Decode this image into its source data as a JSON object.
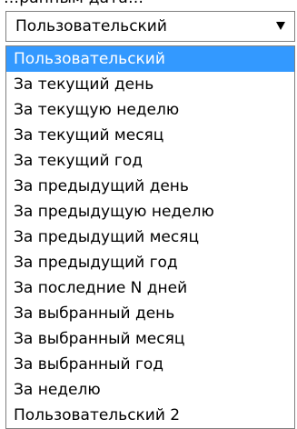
{
  "top_fragment": "…ранным дата…",
  "select": {
    "selected_value": "Пользовательский",
    "icon": "chevron-down-icon"
  },
  "dropdown": {
    "selected_index": 0,
    "options": [
      "Пользовательский",
      "За текущий день",
      "За текущую неделю",
      "За текущий месяц",
      "За текущий год",
      "За предыдущий день",
      "За предыдущую неделю",
      "За предыдущий месяц",
      "За предыдущий год",
      "За последние N дней",
      "За выбранный день",
      "За выбранный месяц",
      "За выбранный год",
      "За неделю",
      "Пользовательский 2"
    ]
  },
  "colors": {
    "highlight": "#3399ff",
    "highlight_text": "#ffffff",
    "border": "#808080"
  }
}
